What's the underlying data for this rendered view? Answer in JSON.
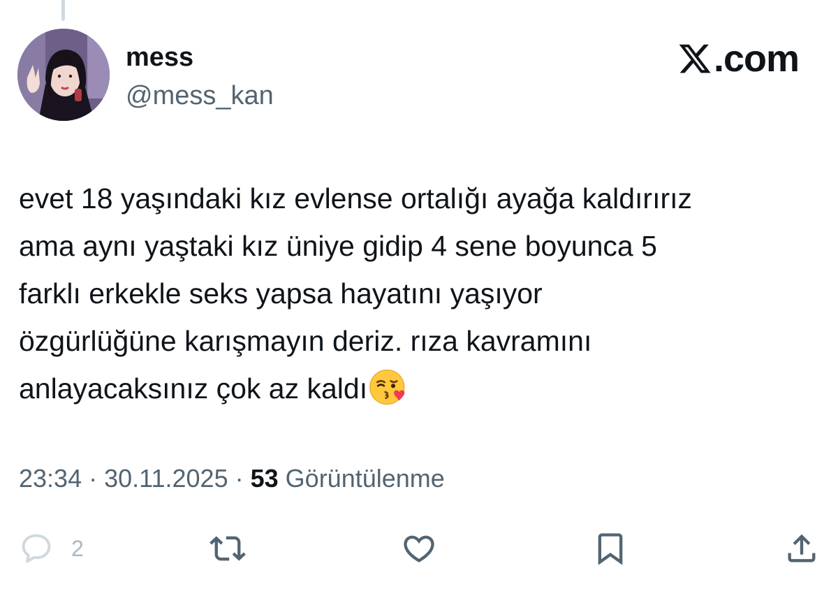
{
  "author": {
    "display_name": "mess",
    "handle": "@mess_kan"
  },
  "brand": {
    "label": ".com"
  },
  "tweet": {
    "text": "evet 18 yaşındaki kız evlense ortalığı ayağa kaldırırız\nama aynı yaştaki kız üniye gidip 4 sene boyunca 5\nfarklı erkekle seks yapsa hayatını yaşıyor\nözgürlüğüne karışmayın deriz. rıza kavramını\nanlayacaksınız çok az kaldı",
    "emoji": "face-blowing-a-kiss"
  },
  "meta": {
    "time": "23:34",
    "separator": " · ",
    "date": "30.11.2025",
    "views_count": "53",
    "views_label": "Görüntülenme"
  },
  "actions": {
    "reply_count": "2"
  },
  "colors": {
    "text": "#0f1419",
    "secondary": "#536471",
    "icon": "#536471",
    "muted_icon": "#cfd9de"
  }
}
